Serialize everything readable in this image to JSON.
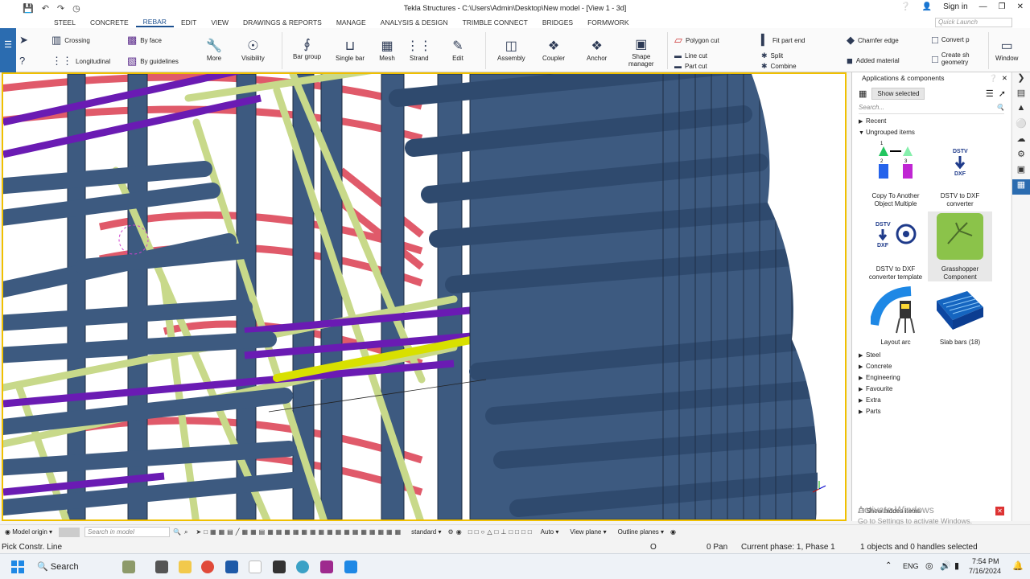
{
  "window": {
    "title": "Tekla Structures - C:\\Users\\Admin\\Desktop\\New model - [View 1 - 3d]",
    "sign_in": "Sign in"
  },
  "menu": {
    "items": [
      "STEEL",
      "CONCRETE",
      "REBAR",
      "EDIT",
      "VIEW",
      "DRAWINGS & REPORTS",
      "MANAGE",
      "ANALYSIS & DESIGN",
      "TRIMBLE CONNECT",
      "BRIDGES",
      "FORMWORK"
    ],
    "active": "REBAR",
    "quick_launch": "Quick Launch"
  },
  "ribbon": {
    "crossing": "Crossing",
    "longitudinal": "Longitudinal",
    "by_face": "By face",
    "by_guidelines": "By guidelines",
    "more": "More",
    "visibility": "Visibility",
    "bar_group": "Bar group",
    "single_bar": "Single bar",
    "mesh": "Mesh",
    "strand": "Strand",
    "edit": "Edit",
    "assembly": "Assembly",
    "coupler": "Coupler",
    "anchor": "Anchor",
    "shape_manager_1": "Shape",
    "shape_manager_2": "manager",
    "polygon_cut": "Polygon cut",
    "line_cut": "Line cut",
    "part_cut": "Part cut",
    "fit_part_end": "Fit part end",
    "split": "Split",
    "combine": "Combine",
    "chamfer_edge": "Chamfer edge",
    "added_material": "Added material",
    "convert": "Convert p",
    "create_1": "Create sh",
    "create_2": "geometry",
    "window": "Window"
  },
  "panel": {
    "title": "Applications & components",
    "show_selected": "Show selected",
    "search_placeholder": "Search...",
    "recent": "Recent",
    "ungrouped": "Ungrouped items",
    "items": [
      {
        "label1": "Copy To Another",
        "label2": "Object Multiple"
      },
      {
        "label1": "DSTV to DXF",
        "label2": "converter"
      },
      {
        "label1": "DSTV to DXF",
        "label2": "converter template"
      },
      {
        "label1": "Grasshopper",
        "label2": "Component"
      },
      {
        "label1": "Layout arc",
        "label2": ""
      },
      {
        "label1": "Slab bars (18)",
        "label2": ""
      }
    ],
    "thumb_text": {
      "dstv": "DSTV",
      "dxf": "DXF",
      "num1": "1",
      "num2": "2",
      "num3": "3"
    },
    "groups": [
      "Steel",
      "Concrete",
      "Engineering",
      "Favourite",
      "Extra",
      "Parts"
    ],
    "show_hidden": "Show hidden items",
    "watermark_1": "Activate Windows",
    "watermark_2": "Go to Settings to activate Windows."
  },
  "bottombar": {
    "model_origin": "Model origin",
    "search_placeholder": "Search in model",
    "standard": "standard",
    "auto": "Auto",
    "view_plane": "View plane",
    "outline_planes": "Outline planes"
  },
  "status": {
    "prompt": "Pick Constr. Line",
    "o": "O",
    "pan": "0  Pan",
    "phase": "Current phase: 1, Phase 1",
    "selection": "1 objects and 0 handles selected"
  },
  "taskbar": {
    "search": "Search",
    "lang": "ENG",
    "time": "7:54 PM",
    "date": "7/16/2024"
  },
  "colors": {
    "bar_blue": "#3d5a80",
    "bar_purple": "#6a1bb3",
    "bar_green": "#c8d98a",
    "bar_red": "#e05a6a",
    "highlight": "#d8e000",
    "frame": "#f0c000",
    "accent": "#1b4f8f"
  }
}
